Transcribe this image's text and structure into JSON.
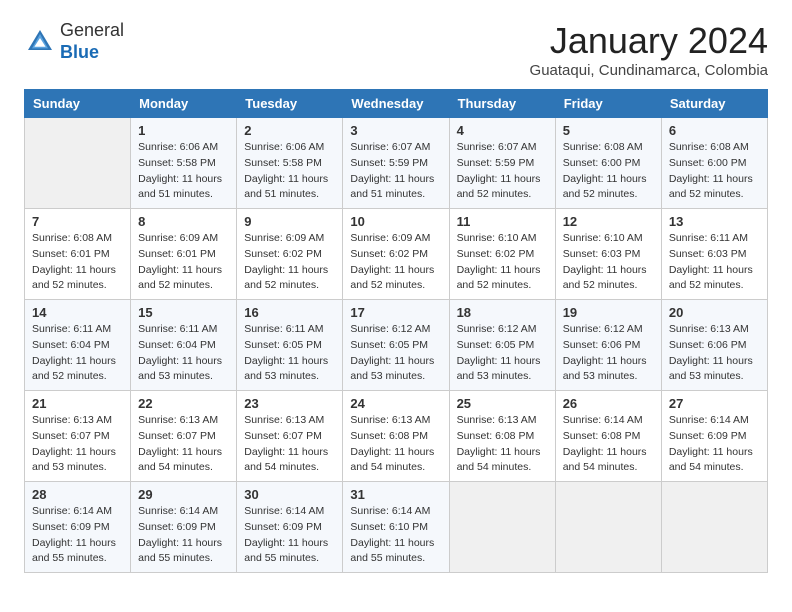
{
  "header": {
    "logo_general": "General",
    "logo_blue": "Blue",
    "month_year": "January 2024",
    "location": "Guataqui, Cundinamarca, Colombia"
  },
  "calendar": {
    "days_of_week": [
      "Sunday",
      "Monday",
      "Tuesday",
      "Wednesday",
      "Thursday",
      "Friday",
      "Saturday"
    ],
    "weeks": [
      [
        {
          "day": "",
          "sunrise": "",
          "sunset": "",
          "daylight": ""
        },
        {
          "day": "1",
          "sunrise": "Sunrise: 6:06 AM",
          "sunset": "Sunset: 5:58 PM",
          "daylight": "Daylight: 11 hours and 51 minutes."
        },
        {
          "day": "2",
          "sunrise": "Sunrise: 6:06 AM",
          "sunset": "Sunset: 5:58 PM",
          "daylight": "Daylight: 11 hours and 51 minutes."
        },
        {
          "day": "3",
          "sunrise": "Sunrise: 6:07 AM",
          "sunset": "Sunset: 5:59 PM",
          "daylight": "Daylight: 11 hours and 51 minutes."
        },
        {
          "day": "4",
          "sunrise": "Sunrise: 6:07 AM",
          "sunset": "Sunset: 5:59 PM",
          "daylight": "Daylight: 11 hours and 52 minutes."
        },
        {
          "day": "5",
          "sunrise": "Sunrise: 6:08 AM",
          "sunset": "Sunset: 6:00 PM",
          "daylight": "Daylight: 11 hours and 52 minutes."
        },
        {
          "day": "6",
          "sunrise": "Sunrise: 6:08 AM",
          "sunset": "Sunset: 6:00 PM",
          "daylight": "Daylight: 11 hours and 52 minutes."
        }
      ],
      [
        {
          "day": "7",
          "sunrise": "Sunrise: 6:08 AM",
          "sunset": "Sunset: 6:01 PM",
          "daylight": "Daylight: 11 hours and 52 minutes."
        },
        {
          "day": "8",
          "sunrise": "Sunrise: 6:09 AM",
          "sunset": "Sunset: 6:01 PM",
          "daylight": "Daylight: 11 hours and 52 minutes."
        },
        {
          "day": "9",
          "sunrise": "Sunrise: 6:09 AM",
          "sunset": "Sunset: 6:02 PM",
          "daylight": "Daylight: 11 hours and 52 minutes."
        },
        {
          "day": "10",
          "sunrise": "Sunrise: 6:09 AM",
          "sunset": "Sunset: 6:02 PM",
          "daylight": "Daylight: 11 hours and 52 minutes."
        },
        {
          "day": "11",
          "sunrise": "Sunrise: 6:10 AM",
          "sunset": "Sunset: 6:02 PM",
          "daylight": "Daylight: 11 hours and 52 minutes."
        },
        {
          "day": "12",
          "sunrise": "Sunrise: 6:10 AM",
          "sunset": "Sunset: 6:03 PM",
          "daylight": "Daylight: 11 hours and 52 minutes."
        },
        {
          "day": "13",
          "sunrise": "Sunrise: 6:11 AM",
          "sunset": "Sunset: 6:03 PM",
          "daylight": "Daylight: 11 hours and 52 minutes."
        }
      ],
      [
        {
          "day": "14",
          "sunrise": "Sunrise: 6:11 AM",
          "sunset": "Sunset: 6:04 PM",
          "daylight": "Daylight: 11 hours and 52 minutes."
        },
        {
          "day": "15",
          "sunrise": "Sunrise: 6:11 AM",
          "sunset": "Sunset: 6:04 PM",
          "daylight": "Daylight: 11 hours and 53 minutes."
        },
        {
          "day": "16",
          "sunrise": "Sunrise: 6:11 AM",
          "sunset": "Sunset: 6:05 PM",
          "daylight": "Daylight: 11 hours and 53 minutes."
        },
        {
          "day": "17",
          "sunrise": "Sunrise: 6:12 AM",
          "sunset": "Sunset: 6:05 PM",
          "daylight": "Daylight: 11 hours and 53 minutes."
        },
        {
          "day": "18",
          "sunrise": "Sunrise: 6:12 AM",
          "sunset": "Sunset: 6:05 PM",
          "daylight": "Daylight: 11 hours and 53 minutes."
        },
        {
          "day": "19",
          "sunrise": "Sunrise: 6:12 AM",
          "sunset": "Sunset: 6:06 PM",
          "daylight": "Daylight: 11 hours and 53 minutes."
        },
        {
          "day": "20",
          "sunrise": "Sunrise: 6:13 AM",
          "sunset": "Sunset: 6:06 PM",
          "daylight": "Daylight: 11 hours and 53 minutes."
        }
      ],
      [
        {
          "day": "21",
          "sunrise": "Sunrise: 6:13 AM",
          "sunset": "Sunset: 6:07 PM",
          "daylight": "Daylight: 11 hours and 53 minutes."
        },
        {
          "day": "22",
          "sunrise": "Sunrise: 6:13 AM",
          "sunset": "Sunset: 6:07 PM",
          "daylight": "Daylight: 11 hours and 54 minutes."
        },
        {
          "day": "23",
          "sunrise": "Sunrise: 6:13 AM",
          "sunset": "Sunset: 6:07 PM",
          "daylight": "Daylight: 11 hours and 54 minutes."
        },
        {
          "day": "24",
          "sunrise": "Sunrise: 6:13 AM",
          "sunset": "Sunset: 6:08 PM",
          "daylight": "Daylight: 11 hours and 54 minutes."
        },
        {
          "day": "25",
          "sunrise": "Sunrise: 6:13 AM",
          "sunset": "Sunset: 6:08 PM",
          "daylight": "Daylight: 11 hours and 54 minutes."
        },
        {
          "day": "26",
          "sunrise": "Sunrise: 6:14 AM",
          "sunset": "Sunset: 6:08 PM",
          "daylight": "Daylight: 11 hours and 54 minutes."
        },
        {
          "day": "27",
          "sunrise": "Sunrise: 6:14 AM",
          "sunset": "Sunset: 6:09 PM",
          "daylight": "Daylight: 11 hours and 54 minutes."
        }
      ],
      [
        {
          "day": "28",
          "sunrise": "Sunrise: 6:14 AM",
          "sunset": "Sunset: 6:09 PM",
          "daylight": "Daylight: 11 hours and 55 minutes."
        },
        {
          "day": "29",
          "sunrise": "Sunrise: 6:14 AM",
          "sunset": "Sunset: 6:09 PM",
          "daylight": "Daylight: 11 hours and 55 minutes."
        },
        {
          "day": "30",
          "sunrise": "Sunrise: 6:14 AM",
          "sunset": "Sunset: 6:09 PM",
          "daylight": "Daylight: 11 hours and 55 minutes."
        },
        {
          "day": "31",
          "sunrise": "Sunrise: 6:14 AM",
          "sunset": "Sunset: 6:10 PM",
          "daylight": "Daylight: 11 hours and 55 minutes."
        },
        {
          "day": "",
          "sunrise": "",
          "sunset": "",
          "daylight": ""
        },
        {
          "day": "",
          "sunrise": "",
          "sunset": "",
          "daylight": ""
        },
        {
          "day": "",
          "sunrise": "",
          "sunset": "",
          "daylight": ""
        }
      ]
    ]
  }
}
